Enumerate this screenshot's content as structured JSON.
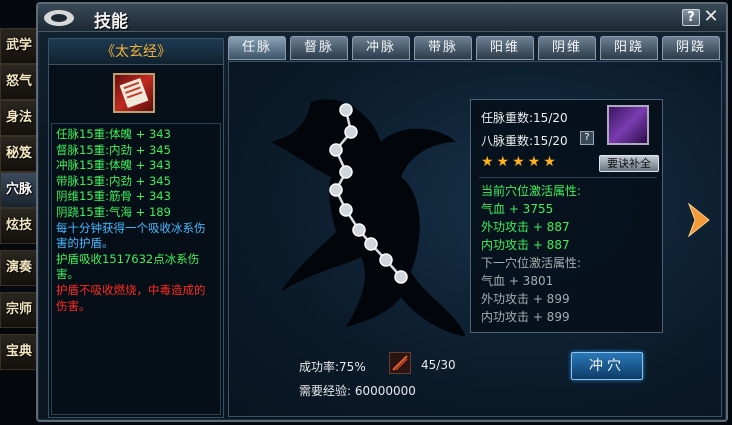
{
  "side_menu": [
    {
      "label": "武学",
      "active": false
    },
    {
      "label": "怒气",
      "active": false
    },
    {
      "label": "身法",
      "active": false
    },
    {
      "label": "秘笈",
      "active": false
    },
    {
      "label": "穴脉",
      "active": true
    },
    {
      "label": "炫技",
      "active": false
    },
    {
      "label": "演奏",
      "active": false
    },
    {
      "label": "宗师",
      "active": false
    },
    {
      "label": "宝典",
      "active": false
    }
  ],
  "window": {
    "title": "技能",
    "help_label": "?",
    "close_label": "✕"
  },
  "left_panel": {
    "book_title": "《太玄经》",
    "lines": [
      {
        "text": "任脉15重:体魄 + 343",
        "color": "g"
      },
      {
        "text": "督脉15重:内劲 + 345",
        "color": "g"
      },
      {
        "text": "冲脉15重:体魄 + 343",
        "color": "g"
      },
      {
        "text": "带脉15重:内劲 + 345",
        "color": "g"
      },
      {
        "text": "阴维15重:筋骨 + 343",
        "color": "g"
      },
      {
        "text": "阴跷15重:气海 + 189",
        "color": "g"
      },
      {
        "text": "每十分钟获得一个吸收冰系伤害的护盾。",
        "color": "b"
      },
      {
        "text": "护盾吸收1517632点冰系伤害。",
        "color": "g"
      },
      {
        "text": "护盾不吸收燃烧，中毒造成的伤害。",
        "color": "r"
      }
    ]
  },
  "tabs": [
    {
      "label": "任脉",
      "active": true
    },
    {
      "label": "督脉",
      "active": false
    },
    {
      "label": "冲脉",
      "active": false
    },
    {
      "label": "带脉",
      "active": false
    },
    {
      "label": "阳维",
      "active": false
    },
    {
      "label": "阴维",
      "active": false
    },
    {
      "label": "阳跷",
      "active": false
    },
    {
      "label": "阴跷",
      "active": false
    }
  ],
  "info": {
    "ren_level": "任脉重数:15/20",
    "ba_level": "八脉重数:15/20",
    "help": "?",
    "stars": "★★★★★",
    "fill_button": "要诀补全",
    "current_title": "当前穴位激活属性:",
    "current_attrs": [
      "气血 + 3755",
      "外功攻击 + 887",
      "内功攻击 + 887"
    ],
    "next_title": "下一穴位激活属性:",
    "next_attrs": [
      "气血 + 3801",
      "外功攻击 + 899",
      "内功攻击 + 899"
    ]
  },
  "bottom": {
    "success_rate": "成功率:75%",
    "item_count": "45/30",
    "exp_needed": "需要经验: 60000000",
    "breach_button": "冲穴"
  },
  "colors": {
    "green": "#3cf05a",
    "blue": "#46b8ff",
    "red": "#ff2a20",
    "gold": "#f5b23a",
    "star": "#ffb01a"
  }
}
